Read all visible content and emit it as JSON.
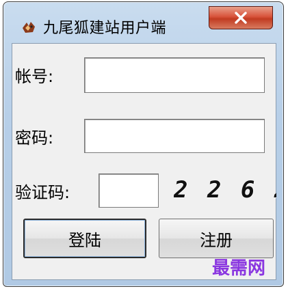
{
  "window": {
    "title": "九尾狐建站用户端",
    "close_label": "x"
  },
  "form": {
    "account_label": "帐号:",
    "account_value": "",
    "password_label": "密码:",
    "password_value": "",
    "captcha_label": "验证码:",
    "captcha_value": "",
    "captcha_image_text": "2 2 6 2"
  },
  "buttons": {
    "login_label": "登陆",
    "register_label": "注册"
  },
  "watermark": {
    "text": "最需网"
  },
  "colors": {
    "title_bar": "#b7cfe8",
    "close_button": "#d04a30",
    "client_bg": "#f0f0f0",
    "watermark": "#8a36e0"
  },
  "icons": {
    "app": "nine-tail-fox-icon",
    "close": "close-icon"
  }
}
